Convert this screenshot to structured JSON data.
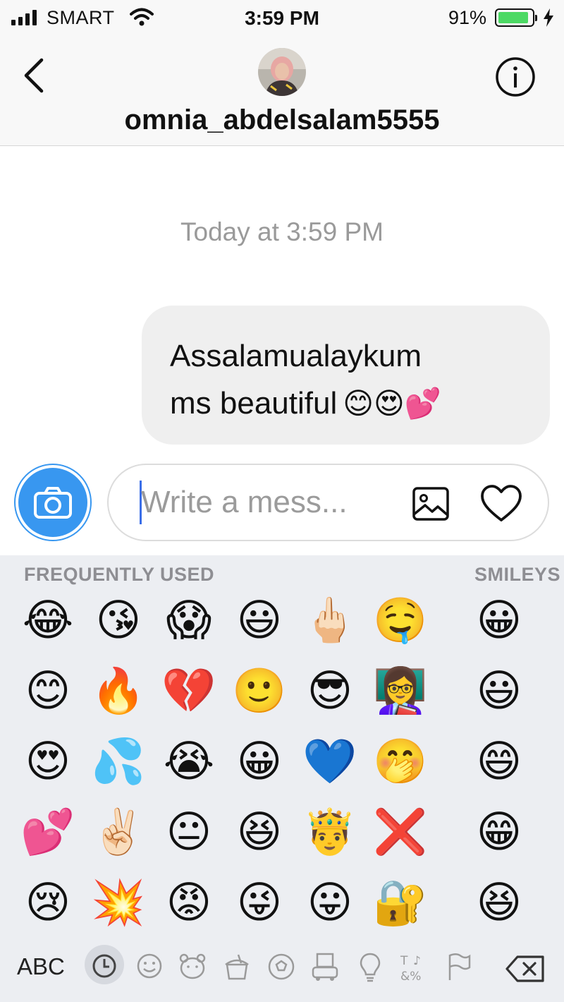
{
  "status_bar": {
    "carrier": "SMART",
    "time": "3:59 PM",
    "battery_percent": "91%",
    "battery_level": 0.91
  },
  "header": {
    "username": "omnia_abdelsalam5555"
  },
  "conversation": {
    "timestamp": "Today at 3:59 PM",
    "messages": [
      {
        "line1": "Assalamualaykum",
        "line2": "ms beautiful",
        "emojis": "😊😍💕"
      }
    ]
  },
  "composer": {
    "placeholder": "Write a mess..."
  },
  "keyboard": {
    "sections": [
      "FREQUENTLY USED",
      "SMILEYS"
    ],
    "frequently_used": [
      [
        "😂",
        "😘",
        "😱",
        "😃",
        "🖕🏻",
        "🤤"
      ],
      [
        "😊",
        "🔥",
        "💔",
        "🙂",
        "😎",
        "👩‍🏫"
      ],
      [
        "😍",
        "💦",
        "😭",
        "😀",
        "💙",
        "🤭"
      ],
      [
        "💕",
        "✌🏻",
        "😐",
        "😆",
        "🤴",
        "❌"
      ],
      [
        "😢",
        "💥",
        "😡",
        "😜",
        "😛",
        "🔐"
      ]
    ],
    "smileys": [
      "😀",
      "😃",
      "😄",
      "😁",
      "😆"
    ],
    "abc_label": "ABC"
  }
}
